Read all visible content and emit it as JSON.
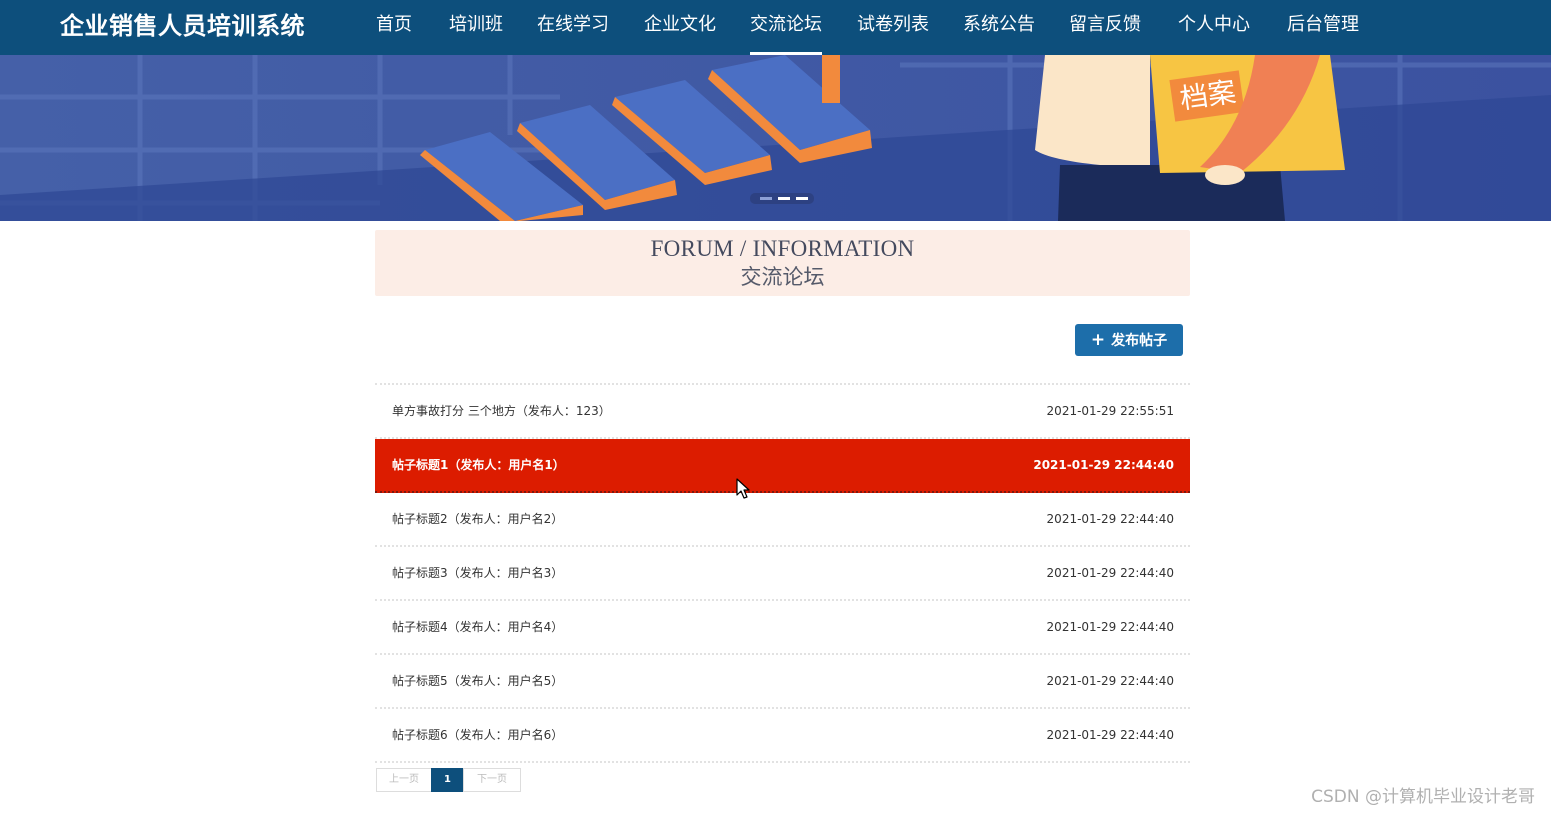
{
  "app": {
    "title": "企业销售人员培训系统"
  },
  "nav": {
    "items": [
      {
        "label": "首页"
      },
      {
        "label": "培训班"
      },
      {
        "label": "在线学习"
      },
      {
        "label": "企业文化"
      },
      {
        "label": "交流论坛",
        "active": true
      },
      {
        "label": "试卷列表"
      },
      {
        "label": "系统公告"
      },
      {
        "label": "留言反馈"
      },
      {
        "label": "个人中心"
      },
      {
        "label": "后台管理"
      }
    ]
  },
  "banner": {
    "sign_text": "档案",
    "indicator_count": 3,
    "active_indicator": 1
  },
  "section": {
    "title_en": "FORUM / INFORMATION",
    "title_cn": "交流论坛"
  },
  "actions": {
    "post_label": "发布帖子",
    "post_icon": "plus-icon"
  },
  "posts": [
    {
      "title": "单方事故打分 三个地方（发布人：123）",
      "time": "2021-01-29 22:55:51"
    },
    {
      "title": "帖子标题1（发布人：用户名1）",
      "time": "2021-01-29 22:44:40",
      "hovered": true
    },
    {
      "title": "帖子标题2（发布人：用户名2）",
      "time": "2021-01-29 22:44:40"
    },
    {
      "title": "帖子标题3（发布人：用户名3）",
      "time": "2021-01-29 22:44:40"
    },
    {
      "title": "帖子标题4（发布人：用户名4）",
      "time": "2021-01-29 22:44:40"
    },
    {
      "title": "帖子标题5（发布人：用户名5）",
      "time": "2021-01-29 22:44:40"
    },
    {
      "title": "帖子标题6（发布人：用户名6）",
      "time": "2021-01-29 22:44:40"
    }
  ],
  "pagination": {
    "prev": "上一页",
    "current": "1",
    "next": "下一页"
  },
  "watermark": "CSDN @计算机毕业设计老哥",
  "colors": {
    "nav_bg": "#0d4f7c",
    "hover_row": "#dc1c00",
    "button": "#1d6eaa",
    "header_bg": "#fcede6"
  }
}
